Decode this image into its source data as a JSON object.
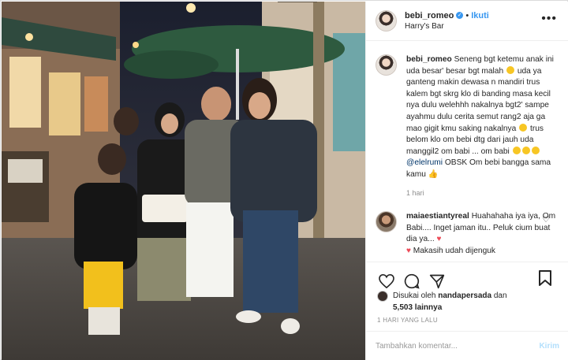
{
  "header": {
    "username": "bebi_romeo",
    "follow_label": "Ikuti",
    "location": "Harry's Bar",
    "verified_icon": "verified-badge-icon",
    "more_icon": "more-options-icon"
  },
  "caption": {
    "username": "bebi_romeo",
    "text_part1": "Seneng bgt ketemu anak ini uda besar' besar bgt malah",
    "text_part2": "uda ya ganteng makin dewasa n mandiri trus kalem bgt skrg klo di banding masa kecil nya dulu welehhh nakalnya bgt2' sampe ayahmu dulu cerita semut rang2 aja ga mao gigit kmu saking nakalnya",
    "text_part3": "trus belom klo om bebi dtg dari jauh uda manggil2 om babi ... om babi",
    "mention": "@elelrumi",
    "text_part4": "OBSK Om bebi bangga sama kamu",
    "time": "1 hari"
  },
  "comment": {
    "username": "maiaestiantyreal",
    "text": "Huahahaha iya iya, Om Babi.... Inget jaman itu.. Peluk cium buat dia ya...",
    "text2": "Makasih udah dijenguk"
  },
  "likes": {
    "prefix": "Disukai oleh",
    "user": "nandapersada",
    "connector": "dan",
    "count": "5,503 lainnya"
  },
  "timestamp": "1 HARI YANG LALU",
  "add_comment": {
    "placeholder": "Tambahkan komentar...",
    "post_label": "Kirim"
  },
  "colors": {
    "accent": "#3897f0",
    "post_disabled": "#b2dffc",
    "heart": "#ed4956"
  }
}
